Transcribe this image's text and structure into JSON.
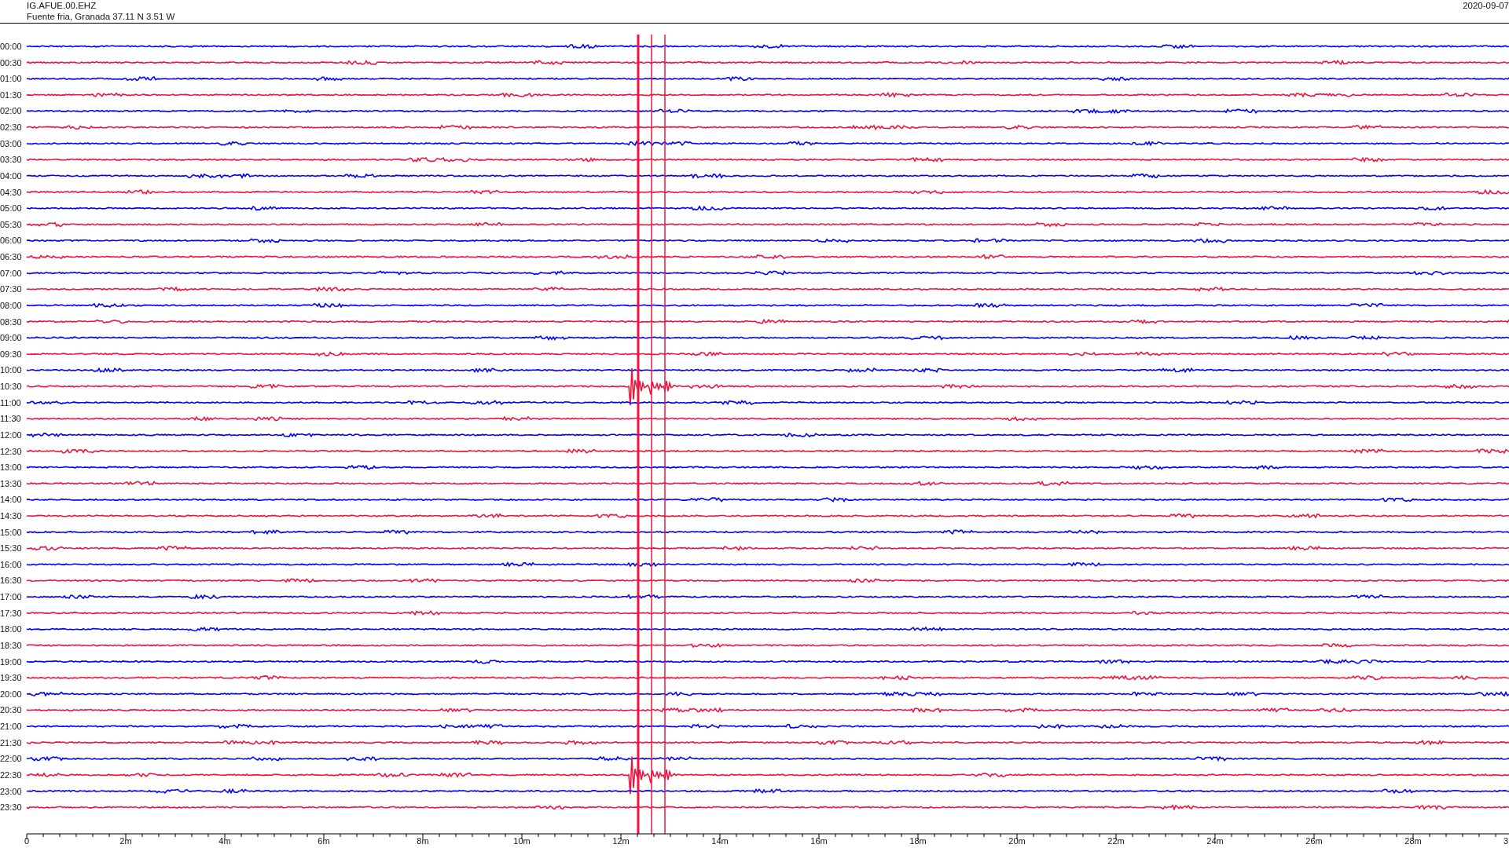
{
  "header": {
    "station": "IG.AFUE.00.EHZ",
    "location": "Fuente fria, Granada  37.11 N 3.51 W",
    "date": "2020-09-07"
  },
  "rows": [
    {
      "time": "00:00",
      "color": "#0000ff"
    },
    {
      "time": "00:30",
      "color": "#f0143c"
    },
    {
      "time": "01:00",
      "color": "#0000ff"
    },
    {
      "time": "01:30",
      "color": "#f0143c"
    },
    {
      "time": "02:00",
      "color": "#0000ff"
    },
    {
      "time": "02:30",
      "color": "#f0143c"
    },
    {
      "time": "03:00",
      "color": "#0000ff"
    },
    {
      "time": "03:30",
      "color": "#f0143c"
    },
    {
      "time": "04:00",
      "color": "#0000ff"
    },
    {
      "time": "04:30",
      "color": "#f0143c"
    },
    {
      "time": "05:00",
      "color": "#0000ff"
    },
    {
      "time": "05:30",
      "color": "#f0143c"
    },
    {
      "time": "06:00",
      "color": "#0000ff"
    },
    {
      "time": "06:30",
      "color": "#f0143c"
    },
    {
      "time": "07:00",
      "color": "#0000ff"
    },
    {
      "time": "07:30",
      "color": "#f0143c"
    },
    {
      "time": "08:00",
      "color": "#0000ff"
    },
    {
      "time": "08:30",
      "color": "#f0143c"
    },
    {
      "time": "09:00",
      "color": "#0000ff"
    },
    {
      "time": "09:30",
      "color": "#f0143c"
    },
    {
      "time": "10:00",
      "color": "#0000ff"
    },
    {
      "time": "10:30",
      "color": "#f0143c"
    },
    {
      "time": "11:00",
      "color": "#0000ff"
    },
    {
      "time": "11:30",
      "color": "#f0143c"
    },
    {
      "time": "12:00",
      "color": "#0000ff"
    },
    {
      "time": "12:30",
      "color": "#f0143c"
    },
    {
      "time": "13:00",
      "color": "#0000ff"
    },
    {
      "time": "13:30",
      "color": "#f0143c"
    },
    {
      "time": "14:00",
      "color": "#0000ff"
    },
    {
      "time": "14:30",
      "color": "#f0143c"
    },
    {
      "time": "15:00",
      "color": "#0000ff"
    },
    {
      "time": "15:30",
      "color": "#f0143c"
    },
    {
      "time": "16:00",
      "color": "#0000ff"
    },
    {
      "time": "16:30",
      "color": "#f0143c"
    },
    {
      "time": "17:00",
      "color": "#0000ff"
    },
    {
      "time": "17:30",
      "color": "#f0143c"
    },
    {
      "time": "18:00",
      "color": "#0000ff"
    },
    {
      "time": "18:30",
      "color": "#f0143c"
    },
    {
      "time": "19:00",
      "color": "#0000ff"
    },
    {
      "time": "19:30",
      "color": "#f0143c"
    },
    {
      "time": "20:00",
      "color": "#0000ff"
    },
    {
      "time": "20:30",
      "color": "#f0143c"
    },
    {
      "time": "21:00",
      "color": "#0000ff"
    },
    {
      "time": "21:30",
      "color": "#f0143c"
    },
    {
      "time": "22:00",
      "color": "#0000ff"
    },
    {
      "time": "22:30",
      "color": "#f0143c"
    },
    {
      "time": "23:00",
      "color": "#0000ff"
    },
    {
      "time": "23:30",
      "color": "#f0143c"
    }
  ],
  "x_axis": {
    "ticks": [
      "0",
      "2m",
      "4m",
      "6m",
      "8m",
      "10m",
      "12m",
      "14m",
      "16m",
      "18m",
      "20m",
      "22m",
      "24m",
      "26m",
      "28m",
      "3"
    ]
  }
}
